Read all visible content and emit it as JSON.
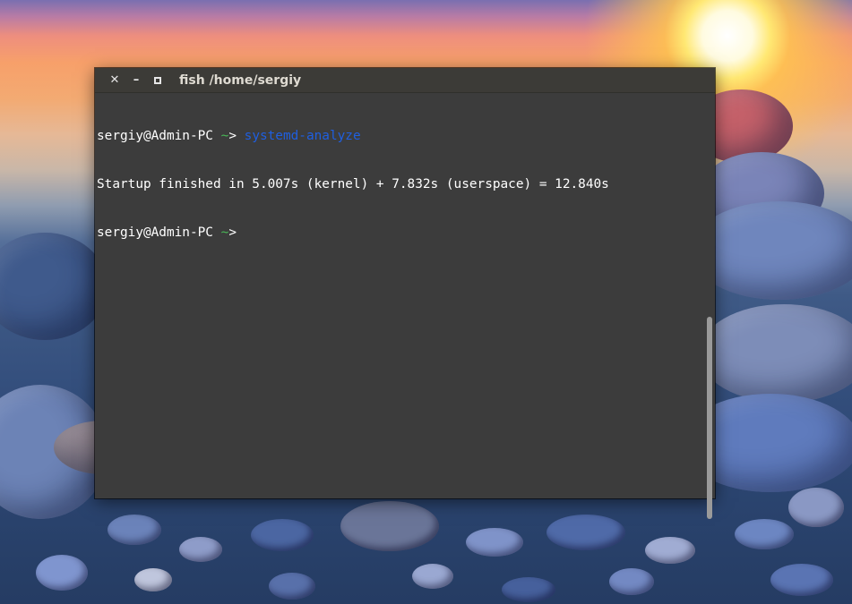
{
  "window": {
    "title_app": "fish",
    "title_path": "/home/sergiy"
  },
  "terminal": {
    "line1": {
      "user_host": "sergiy@Admin-PC",
      "cwd": "~",
      "prompt_symbol": ">",
      "command": "systemd-analyze"
    },
    "line2": {
      "output": "Startup finished in 5.007s (kernel) + 7.832s (userspace) = 12.840s"
    },
    "line3": {
      "user_host": "sergiy@Admin-PC",
      "cwd": "~",
      "prompt_symbol": ">"
    }
  },
  "icons": {
    "close": "close-icon",
    "minimize": "minimize-icon",
    "maximize": "maximize-icon"
  },
  "colors": {
    "terminal_bg": "#3c3c3c",
    "titlebar_bg": "#3c3b37",
    "prompt_path": "#49b957",
    "command": "#1f5fe0",
    "text": "#ffffff"
  }
}
